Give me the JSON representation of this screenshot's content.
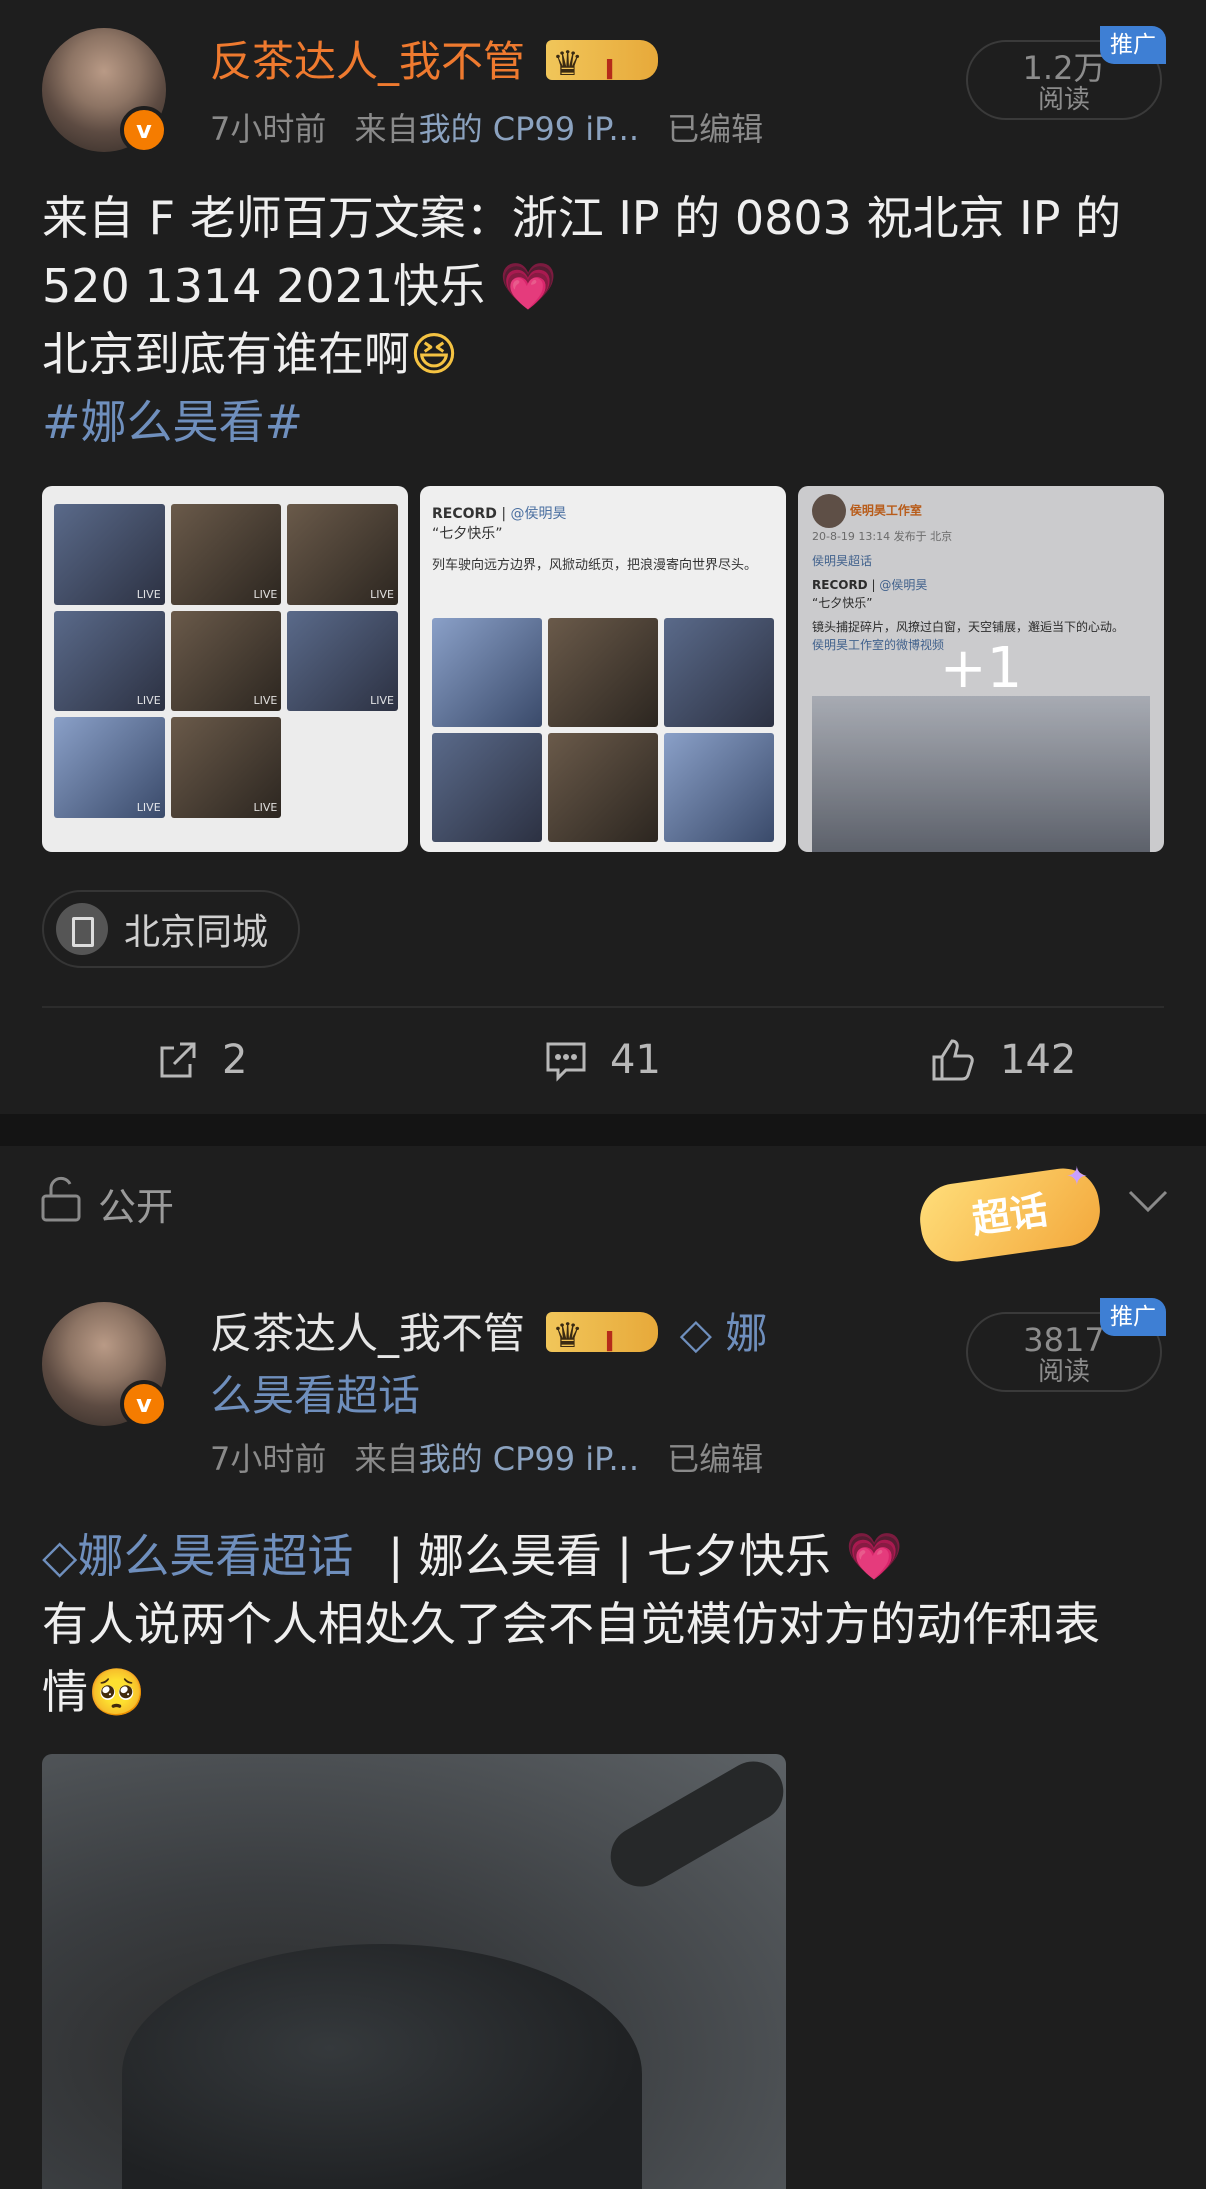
{
  "post1": {
    "username": "反茶达人_我不管",
    "time": "7小时前",
    "from_prefix": "来自",
    "source": "我的 CP99 iP...",
    "edited": "已编辑",
    "reads": "1.2万",
    "reads_label": "阅读",
    "promo_badge": "推广",
    "text_line1": "来自 F 老师百万文案：浙江 IP 的 0803 祝北京 IP 的",
    "text_line2": "520 1314  2021快乐",
    "text_line3": "北京到底有谁在啊",
    "hashtag": "#娜么昊看#",
    "image_card2": {
      "record": "RECORD",
      "author": "@侯明昊",
      "title": "“七夕快乐”",
      "body": "列车驶向远方边界，风掀动纸页，把浪漫寄向世界尽头。"
    },
    "image_card3": {
      "account": "侯明昊工作室",
      "date": "20-8-19 13:14",
      "posted_in": "发布于 北京",
      "supertopic": "侯明昊超话",
      "record": "RECORD",
      "author": "@侯明昊",
      "title": "“七夕快乐”",
      "body": "镜头捕捉碎片，风撩过白窗，天空铺展，邂逅当下的心动。",
      "footer": "侯明昊工作室的微博视频",
      "more_count": "+1"
    },
    "live_tag": "LIVE",
    "location": "北京同城",
    "shares": "2",
    "comments": "41",
    "likes": "142"
  },
  "visibility_bar": {
    "label": "公开",
    "supertopic_chip": "超话"
  },
  "post2": {
    "username": "反茶达人_我不管",
    "supertopic_name": "娜么昊看超话",
    "supertopic_line1": "娜",
    "supertopic_line2": "么昊看超话",
    "time": "7小时前",
    "from_prefix": "来自",
    "source": "我的 CP99 iP...",
    "edited": "已编辑",
    "reads": "3817",
    "reads_label": "阅读",
    "promo_badge": "推广",
    "text_tags": " | 娜么昊看 | 七夕快乐",
    "text_line2": "有人说两个人相处久了会不自觉模仿对方的动作和表",
    "text_line3": "情"
  },
  "colors": {
    "background": "#1e1e1e",
    "username_orange": "#ef7a2f",
    "topic_blue": "#6f8fbd",
    "promo_blue": "#3e7fd4",
    "verified_orange": "#f57c00"
  }
}
